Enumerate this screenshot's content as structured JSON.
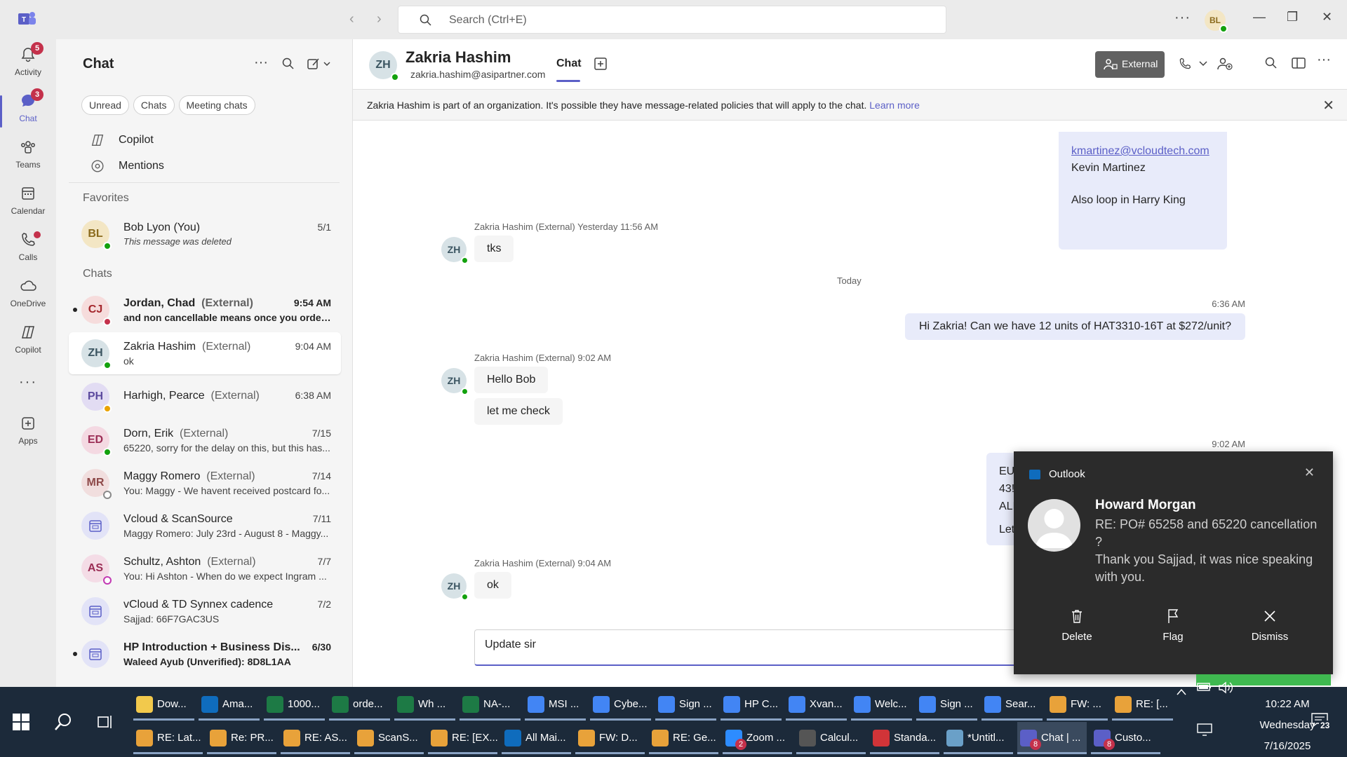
{
  "search": {
    "placeholder": "Search (Ctrl+E)"
  },
  "title_avatar": "BL",
  "rail": [
    {
      "label": "Activity",
      "badge": "5"
    },
    {
      "label": "Chat",
      "badge": "3"
    },
    {
      "label": "Teams"
    },
    {
      "label": "Calendar"
    },
    {
      "label": "Calls"
    },
    {
      "label": "OneDrive"
    },
    {
      "label": "Copilot"
    },
    {
      "label": "Apps"
    }
  ],
  "chatlist": {
    "title": "Chat",
    "filters": [
      "Unread",
      "Chats",
      "Meeting chats"
    ],
    "pinned": [
      "Copilot",
      "Mentions"
    ],
    "favorites_header": "Favorites",
    "chats_header": "Chats",
    "favorites": [
      {
        "initials": "BL",
        "name": "Bob Lyon (You)",
        "ext": "",
        "preview": "This message was deleted",
        "time": "5/1"
      }
    ],
    "chats": [
      {
        "initials": "CJ",
        "name": "Jordan, Chad",
        "ext": "(External)",
        "preview": "and non cancellable means once you order, i...",
        "time": "9:54 AM"
      },
      {
        "initials": "ZH",
        "name": "Zakria Hashim",
        "ext": "(External)",
        "preview": "ok",
        "time": "9:04 AM"
      },
      {
        "initials": "PH",
        "name": "Harhigh, Pearce",
        "ext": "(External)",
        "preview": "",
        "time": "6:38 AM"
      },
      {
        "initials": "ED",
        "name": "Dorn, Erik",
        "ext": "(External)",
        "preview": "65220, sorry for the delay on this, but this has...",
        "time": "7/15"
      },
      {
        "initials": "MR",
        "name": "Maggy Romero",
        "ext": "(External)",
        "preview": "You: Maggy - We havent received postcard fo...",
        "time": "7/14"
      },
      {
        "initials": "",
        "name": "Vcloud & ScanSource",
        "ext": "",
        "preview": "Maggy Romero: July 23rd - August 8 - Maggy...",
        "time": "7/11"
      },
      {
        "initials": "AS",
        "name": "Schultz, Ashton",
        "ext": "(External)",
        "preview": "You: Hi Ashton -  When do we expect Ingram ...",
        "time": "7/7"
      },
      {
        "initials": "",
        "name": "vCloud & TD Synnex cadence",
        "ext": "",
        "preview": "Sajjad: 66F7GAC3US",
        "time": "7/2"
      },
      {
        "initials": "",
        "name": "HP Introduction + Business Dis...",
        "ext": "",
        "preview": "Waleed Ayub (Unverified): 8D8L1AA",
        "time": "6/30"
      }
    ]
  },
  "conversation": {
    "header": {
      "initials": "ZH",
      "name": "Zakria Hashim",
      "email": "zakria.hashim@asipartner.com",
      "tab": "Chat",
      "external_label": "External"
    },
    "banner": {
      "text": "Zakria Hashim is part of an organization. It's possible they have message-related policies that will apply to the chat. ",
      "link": "Learn more"
    },
    "out_top": {
      "email": "kmartinez@vcloudtech.com",
      "line1": "Kevin Martinez",
      "line2": "Also loop in Harry King"
    },
    "group1": {
      "meta": "Zakria Hashim (External)  Yesterday 11:56 AM",
      "msg": "tks"
    },
    "day_sep": "Today",
    "out1": {
      "time": "6:36 AM",
      "msg": "Hi Zakria! Can we have 12 units of HAT3310-16T at $272/unit?"
    },
    "group2": {
      "meta": "Zakria Hashim (External)  9:02 AM",
      "msg1": "Hello Bob",
      "msg2": "let me check"
    },
    "out2": {
      "time": "9:02 AM",
      "lines": [
        "EU",
        "43!",
        "ALL",
        "Let"
      ]
    },
    "group3": {
      "meta": "Zakria Hashim (External)  9:04 AM",
      "msg": "ok"
    },
    "compose_value": "Update sir"
  },
  "toast": {
    "app": "Outlook",
    "sender": "Howard Morgan",
    "subject": "RE: PO# 65258 and 65220 cancellation ?",
    "body": "Thank you Sajjad, it was nice speaking with you.",
    "actions": [
      "Delete",
      "Flag",
      "Dismiss"
    ]
  },
  "taskbar": {
    "row1": [
      {
        "label": "Dow...",
        "color": "#f2c94c"
      },
      {
        "label": "Ama...",
        "color": "#0f6cbd"
      },
      {
        "label": "1000...",
        "color": "#1d7a45"
      },
      {
        "label": "orde...",
        "color": "#1d7a45"
      },
      {
        "label": "Wh ...",
        "color": "#1d7a45"
      },
      {
        "label": "NA-...",
        "color": "#1d7a45"
      },
      {
        "label": "MSI ...",
        "color": "#4285f4"
      },
      {
        "label": "Cybe...",
        "color": "#4285f4"
      },
      {
        "label": "Sign ...",
        "color": "#4285f4"
      },
      {
        "label": "HP C...",
        "color": "#4285f4"
      },
      {
        "label": "Xvan...",
        "color": "#4285f4"
      },
      {
        "label": "Welc...",
        "color": "#4285f4"
      },
      {
        "label": "Sign ...",
        "color": "#4285f4"
      },
      {
        "label": "Sear...",
        "color": "#4285f4"
      },
      {
        "label": "FW: ...",
        "color": "#e8a23a"
      },
      {
        "label": "RE: [...",
        "color": "#e8a23a"
      }
    ],
    "row2": [
      {
        "label": "RE: Lat...",
        "color": "#e8a23a"
      },
      {
        "label": "Re: PR...",
        "color": "#e8a23a"
      },
      {
        "label": "RE: AS...",
        "color": "#e8a23a"
      },
      {
        "label": "ScanS...",
        "color": "#e8a23a"
      },
      {
        "label": "RE: [EX...",
        "color": "#e8a23a"
      },
      {
        "label": "All Mai...",
        "color": "#0f6cbd"
      },
      {
        "label": "FW: D...",
        "color": "#e8a23a"
      },
      {
        "label": "RE: Ge...",
        "color": "#e8a23a"
      },
      {
        "label": "Zoom ...",
        "color": "#2d8cff",
        "badge": "2"
      },
      {
        "label": "Calcul...",
        "color": "#555555"
      },
      {
        "label": "Standa...",
        "color": "#d13438"
      },
      {
        "label": "*Untitl...",
        "color": "#6aa0c8"
      },
      {
        "label": "Chat | ...",
        "color": "#5b5fc7",
        "badge": "8"
      },
      {
        "label": "Custo...",
        "color": "#5b5fc7",
        "badge": "8"
      }
    ],
    "clock": {
      "time": "10:22 AM",
      "day": "Wednesday",
      "date": "7/16/2025"
    },
    "notif_count": "23"
  }
}
